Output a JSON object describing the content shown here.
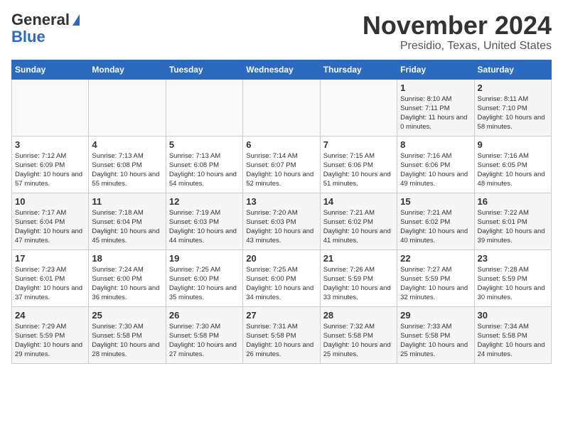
{
  "header": {
    "logo_general": "General",
    "logo_blue": "Blue",
    "month": "November 2024",
    "location": "Presidio, Texas, United States"
  },
  "weekdays": [
    "Sunday",
    "Monday",
    "Tuesday",
    "Wednesday",
    "Thursday",
    "Friday",
    "Saturday"
  ],
  "weeks": [
    [
      {
        "day": "",
        "sunrise": "",
        "sunset": "",
        "daylight": ""
      },
      {
        "day": "",
        "sunrise": "",
        "sunset": "",
        "daylight": ""
      },
      {
        "day": "",
        "sunrise": "",
        "sunset": "",
        "daylight": ""
      },
      {
        "day": "",
        "sunrise": "",
        "sunset": "",
        "daylight": ""
      },
      {
        "day": "",
        "sunrise": "",
        "sunset": "",
        "daylight": ""
      },
      {
        "day": "1",
        "sunrise": "Sunrise: 8:10 AM",
        "sunset": "Sunset: 7:11 PM",
        "daylight": "Daylight: 11 hours and 0 minutes."
      },
      {
        "day": "2",
        "sunrise": "Sunrise: 8:11 AM",
        "sunset": "Sunset: 7:10 PM",
        "daylight": "Daylight: 10 hours and 58 minutes."
      }
    ],
    [
      {
        "day": "3",
        "sunrise": "Sunrise: 7:12 AM",
        "sunset": "Sunset: 6:09 PM",
        "daylight": "Daylight: 10 hours and 57 minutes."
      },
      {
        "day": "4",
        "sunrise": "Sunrise: 7:13 AM",
        "sunset": "Sunset: 6:08 PM",
        "daylight": "Daylight: 10 hours and 55 minutes."
      },
      {
        "day": "5",
        "sunrise": "Sunrise: 7:13 AM",
        "sunset": "Sunset: 6:08 PM",
        "daylight": "Daylight: 10 hours and 54 minutes."
      },
      {
        "day": "6",
        "sunrise": "Sunrise: 7:14 AM",
        "sunset": "Sunset: 6:07 PM",
        "daylight": "Daylight: 10 hours and 52 minutes."
      },
      {
        "day": "7",
        "sunrise": "Sunrise: 7:15 AM",
        "sunset": "Sunset: 6:06 PM",
        "daylight": "Daylight: 10 hours and 51 minutes."
      },
      {
        "day": "8",
        "sunrise": "Sunrise: 7:16 AM",
        "sunset": "Sunset: 6:06 PM",
        "daylight": "Daylight: 10 hours and 49 minutes."
      },
      {
        "day": "9",
        "sunrise": "Sunrise: 7:16 AM",
        "sunset": "Sunset: 6:05 PM",
        "daylight": "Daylight: 10 hours and 48 minutes."
      }
    ],
    [
      {
        "day": "10",
        "sunrise": "Sunrise: 7:17 AM",
        "sunset": "Sunset: 6:04 PM",
        "daylight": "Daylight: 10 hours and 47 minutes."
      },
      {
        "day": "11",
        "sunrise": "Sunrise: 7:18 AM",
        "sunset": "Sunset: 6:04 PM",
        "daylight": "Daylight: 10 hours and 45 minutes."
      },
      {
        "day": "12",
        "sunrise": "Sunrise: 7:19 AM",
        "sunset": "Sunset: 6:03 PM",
        "daylight": "Daylight: 10 hours and 44 minutes."
      },
      {
        "day": "13",
        "sunrise": "Sunrise: 7:20 AM",
        "sunset": "Sunset: 6:03 PM",
        "daylight": "Daylight: 10 hours and 43 minutes."
      },
      {
        "day": "14",
        "sunrise": "Sunrise: 7:21 AM",
        "sunset": "Sunset: 6:02 PM",
        "daylight": "Daylight: 10 hours and 41 minutes."
      },
      {
        "day": "15",
        "sunrise": "Sunrise: 7:21 AM",
        "sunset": "Sunset: 6:02 PM",
        "daylight": "Daylight: 10 hours and 40 minutes."
      },
      {
        "day": "16",
        "sunrise": "Sunrise: 7:22 AM",
        "sunset": "Sunset: 6:01 PM",
        "daylight": "Daylight: 10 hours and 39 minutes."
      }
    ],
    [
      {
        "day": "17",
        "sunrise": "Sunrise: 7:23 AM",
        "sunset": "Sunset: 6:01 PM",
        "daylight": "Daylight: 10 hours and 37 minutes."
      },
      {
        "day": "18",
        "sunrise": "Sunrise: 7:24 AM",
        "sunset": "Sunset: 6:00 PM",
        "daylight": "Daylight: 10 hours and 36 minutes."
      },
      {
        "day": "19",
        "sunrise": "Sunrise: 7:25 AM",
        "sunset": "Sunset: 6:00 PM",
        "daylight": "Daylight: 10 hours and 35 minutes."
      },
      {
        "day": "20",
        "sunrise": "Sunrise: 7:25 AM",
        "sunset": "Sunset: 6:00 PM",
        "daylight": "Daylight: 10 hours and 34 minutes."
      },
      {
        "day": "21",
        "sunrise": "Sunrise: 7:26 AM",
        "sunset": "Sunset: 5:59 PM",
        "daylight": "Daylight: 10 hours and 33 minutes."
      },
      {
        "day": "22",
        "sunrise": "Sunrise: 7:27 AM",
        "sunset": "Sunset: 5:59 PM",
        "daylight": "Daylight: 10 hours and 32 minutes."
      },
      {
        "day": "23",
        "sunrise": "Sunrise: 7:28 AM",
        "sunset": "Sunset: 5:59 PM",
        "daylight": "Daylight: 10 hours and 30 minutes."
      }
    ],
    [
      {
        "day": "24",
        "sunrise": "Sunrise: 7:29 AM",
        "sunset": "Sunset: 5:59 PM",
        "daylight": "Daylight: 10 hours and 29 minutes."
      },
      {
        "day": "25",
        "sunrise": "Sunrise: 7:30 AM",
        "sunset": "Sunset: 5:58 PM",
        "daylight": "Daylight: 10 hours and 28 minutes."
      },
      {
        "day": "26",
        "sunrise": "Sunrise: 7:30 AM",
        "sunset": "Sunset: 5:58 PM",
        "daylight": "Daylight: 10 hours and 27 minutes."
      },
      {
        "day": "27",
        "sunrise": "Sunrise: 7:31 AM",
        "sunset": "Sunset: 5:58 PM",
        "daylight": "Daylight: 10 hours and 26 minutes."
      },
      {
        "day": "28",
        "sunrise": "Sunrise: 7:32 AM",
        "sunset": "Sunset: 5:58 PM",
        "daylight": "Daylight: 10 hours and 25 minutes."
      },
      {
        "day": "29",
        "sunrise": "Sunrise: 7:33 AM",
        "sunset": "Sunset: 5:58 PM",
        "daylight": "Daylight: 10 hours and 25 minutes."
      },
      {
        "day": "30",
        "sunrise": "Sunrise: 7:34 AM",
        "sunset": "Sunset: 5:58 PM",
        "daylight": "Daylight: 10 hours and 24 minutes."
      }
    ]
  ]
}
